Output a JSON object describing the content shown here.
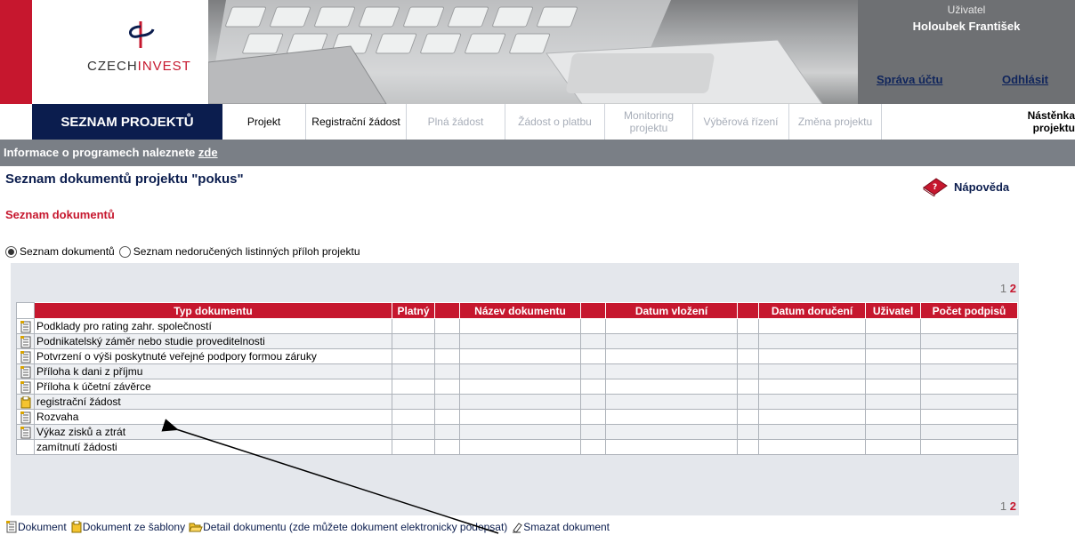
{
  "header": {
    "logo_text_a": "CZECH",
    "logo_text_b": "INVEST",
    "user_label": "Uživatel",
    "user_name": "Holoubek František",
    "account_link": "Správa účtu",
    "logout_link": "Odhlásit"
  },
  "nav": {
    "first": "SEZNAM PROJEKTŮ",
    "items": [
      {
        "label": "Projekt",
        "state": "active"
      },
      {
        "label": "Registrační žádost",
        "state": "active"
      },
      {
        "label": "Plná žádost",
        "state": "disabled"
      },
      {
        "label": "Žádost o platbu",
        "state": "disabled"
      },
      {
        "label": "Monitoring projektu",
        "state": "disabled"
      },
      {
        "label": "Výběrová řízení",
        "state": "disabled"
      },
      {
        "label": "Změna projektu",
        "state": "disabled"
      },
      {
        "label": "Nástěnka projektu",
        "state": "active"
      }
    ]
  },
  "infobar": {
    "text": "Informace o programech naleznete ",
    "link": "zde"
  },
  "page": {
    "title": "Seznam dokumentů projektu  \"pokus\"",
    "help": "Nápověda",
    "section_title": "Seznam dokumentů",
    "radio_1": "Seznam dokumentů",
    "radio_2": "Seznam nedoručených listinných příloh projektu"
  },
  "pager": {
    "current": "1",
    "next": "2"
  },
  "table": {
    "headers": [
      "Typ dokumentu",
      "Platný",
      "Název dokumentu",
      "Datum vložení",
      "Datum doručení",
      "Uživatel",
      "Počet podpisů"
    ],
    "rows": [
      {
        "icon": "document-icon",
        "type": "Podklady pro rating zahr. společností"
      },
      {
        "icon": "document-icon",
        "type": "Podnikatelský záměr nebo studie proveditelnosti"
      },
      {
        "icon": "document-icon",
        "type": "Potvrzení o výši poskytnuté veřejné podpory formou záruky"
      },
      {
        "icon": "document-icon",
        "type": "Příloha k dani z příjmu"
      },
      {
        "icon": "document-icon",
        "type": "Příloha k účetní závěrce"
      },
      {
        "icon": "template-document-icon",
        "type": "registrační žádost"
      },
      {
        "icon": "document-icon",
        "type": "Rozvaha"
      },
      {
        "icon": "document-icon",
        "type": "Výkaz zisků a ztrát"
      },
      {
        "icon": "",
        "type": "zamítnutí žádosti"
      }
    ]
  },
  "legend": {
    "document": "Dokument",
    "template_document": "Dokument ze šablony",
    "detail": "Detail dokumentu (zde můžete dokument elektronicky podepsat)",
    "delete": "Smazat dokument"
  },
  "colors": {
    "brand_red": "#c6172e",
    "navy": "#0b1d4e",
    "gray_bar": "#7a7f86"
  }
}
